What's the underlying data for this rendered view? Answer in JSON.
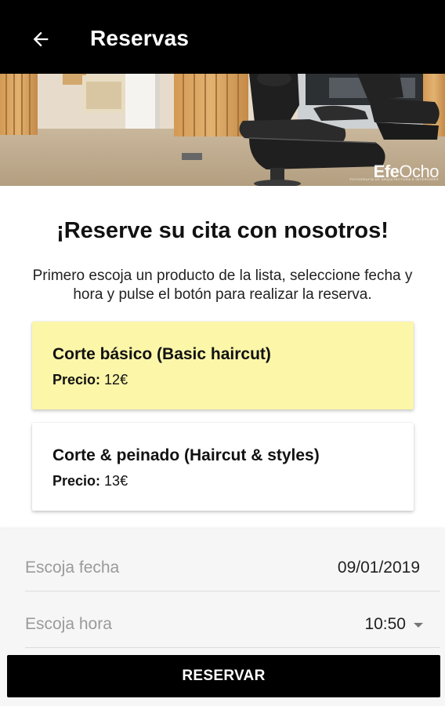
{
  "topbar": {
    "title": "Reservas",
    "back_icon": "arrow-left-icon"
  },
  "hero": {
    "watermark_bold": "Efe",
    "watermark_light": "Ocho",
    "watermark_sub": "FOTOGRAFÍA DE ARQUITECTURA E INTERIORES"
  },
  "content": {
    "heading": "¡Reserve su cita con nosotros!",
    "intro": "Primero escoja un producto de la lista, seleccione fecha y hora y pulse el botón para realizar la reserva."
  },
  "products": [
    {
      "name": "Corte básico (Basic haircut)",
      "price_label": "Precio:",
      "price": "12€",
      "selected": true
    },
    {
      "name": "Corte & peinado (Haircut & styles)",
      "price_label": "Precio:",
      "price": "13€",
      "selected": false
    }
  ],
  "form": {
    "date_label": "Escoja fecha",
    "date_value": "09/01/2019",
    "time_label": "Escoja hora",
    "time_value": "10:50",
    "time_icon": "dropdown-arrow-icon"
  },
  "actions": {
    "reserve_label": "RESERVAR"
  },
  "colors": {
    "topbar": "#000000",
    "selected_card": "#fcf6a9",
    "button": "#000000"
  }
}
